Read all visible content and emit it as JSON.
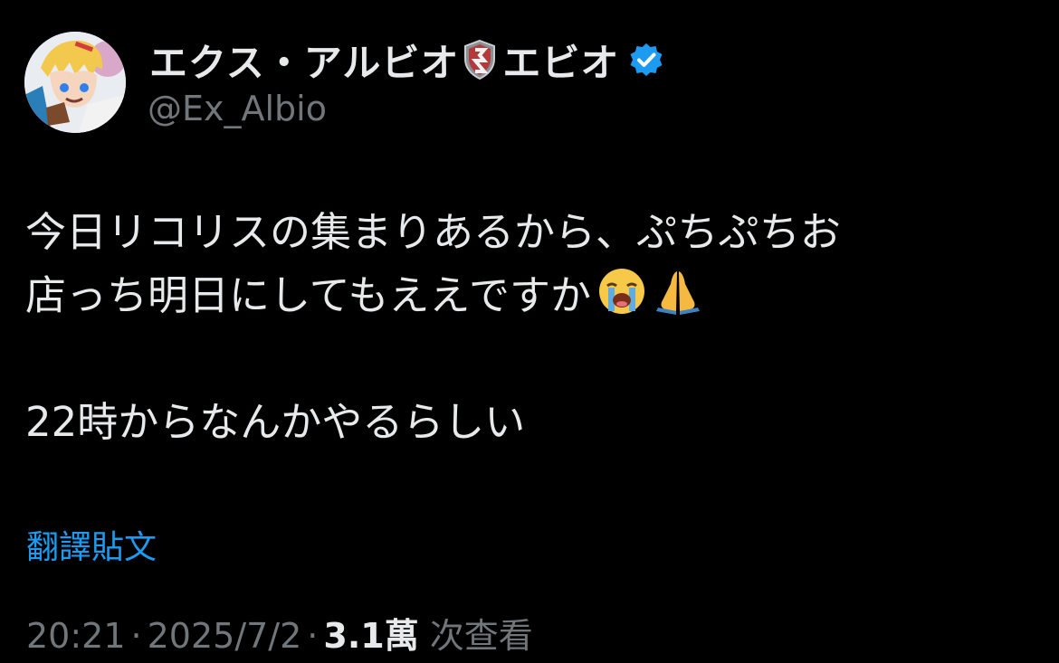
{
  "tweet": {
    "author": {
      "display_name": "エクス・アルビオ",
      "name_suffix": "エビオ",
      "handle": "@Ex_Albio",
      "verified": true,
      "icons": [
        "avatar",
        "shield-icon",
        "verified-badge-icon"
      ]
    },
    "text_lines": [
      "今日リコリスの集まりあるから、ぷちぷちお",
      "店っち明日にしてもええですか",
      "",
      "22時からなんかやるらしい"
    ],
    "emojis": [
      "loudly-crying-face-icon",
      "folded-hands-icon"
    ],
    "translate_label": "翻譯貼文",
    "time": "20:21",
    "date": "2025/7/2",
    "separator": "·",
    "views_count": "3.1萬",
    "views_label": "次查看"
  },
  "colors": {
    "background": "#000000",
    "primary_text": "#e7e9ea",
    "secondary_text": "#71767b",
    "link": "#1d9bf0",
    "verified": "#1d9bf0"
  }
}
